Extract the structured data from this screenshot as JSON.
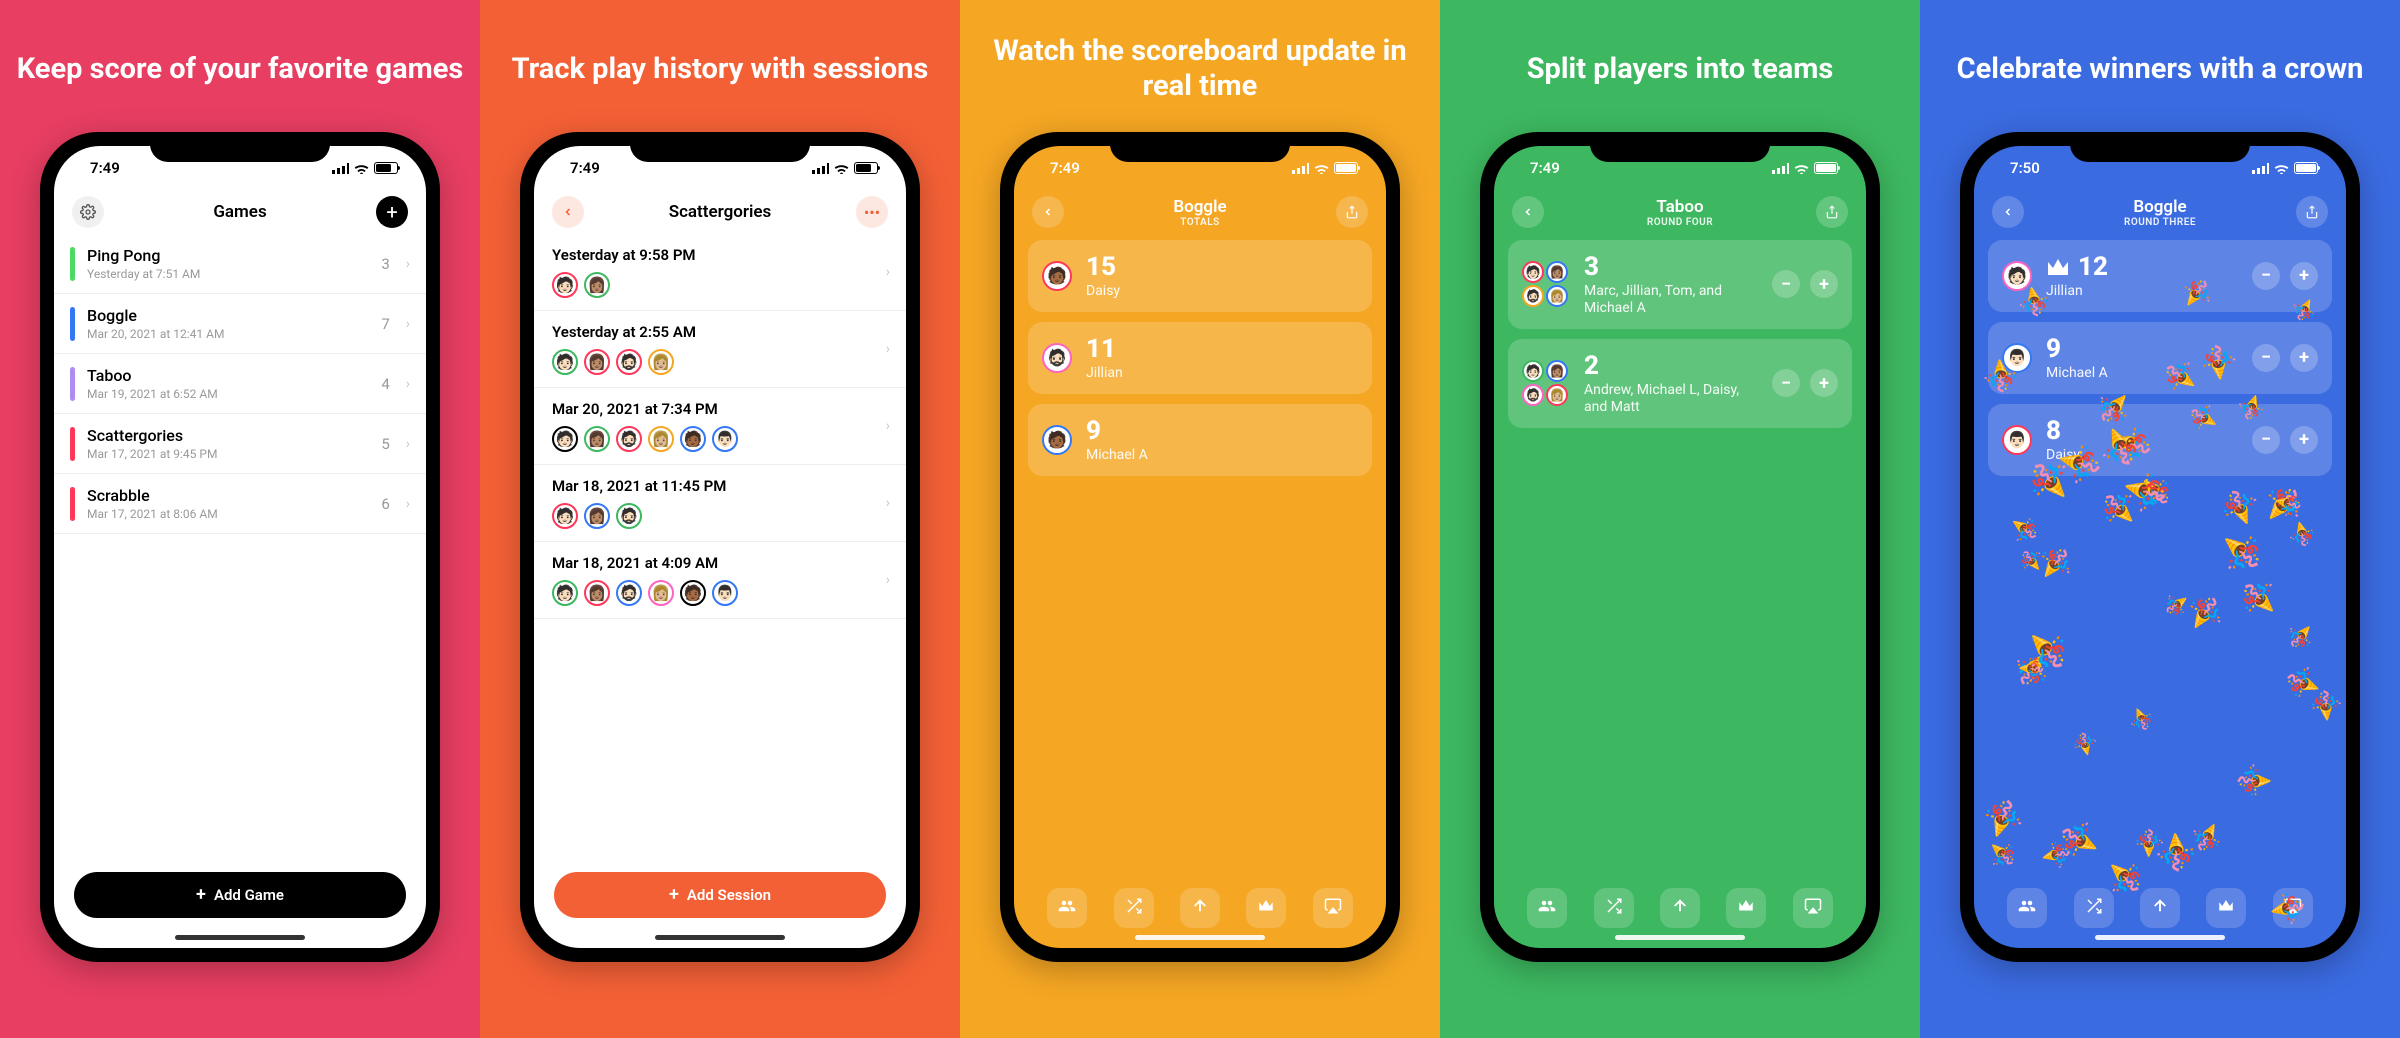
{
  "panels": [
    {
      "headline": "Keep score of your favorite games"
    },
    {
      "headline": "Track play history with sessions"
    },
    {
      "headline": "Watch the scoreboard update in real time"
    },
    {
      "headline": "Split players into teams"
    },
    {
      "headline": "Celebrate winners with a crown"
    }
  ],
  "status_time": {
    "a": "7:49",
    "b": "7:50"
  },
  "screen1": {
    "nav_title": "Games",
    "add_label": "Add Game",
    "games": [
      {
        "name": "Ping Pong",
        "sub": "Yesterday at 7:51 AM",
        "count": "3",
        "color": "#4cd964"
      },
      {
        "name": "Boggle",
        "sub": "Mar 20, 2021 at 12:41 AM",
        "count": "7",
        "color": "#3478f6"
      },
      {
        "name": "Taboo",
        "sub": "Mar 19, 2021 at 6:52 AM",
        "count": "4",
        "color": "#af8cf0"
      },
      {
        "name": "Scattergories",
        "sub": "Mar 17, 2021 at 9:45 PM",
        "count": "5",
        "color": "#ff3759"
      },
      {
        "name": "Scrabble",
        "sub": "Mar 17, 2021 at 8:06 AM",
        "count": "6",
        "color": "#ff3759"
      }
    ]
  },
  "screen2": {
    "nav_title": "Scattergories",
    "add_label": "Add Session",
    "sessions": [
      {
        "when": "Yesterday at 9:58 PM",
        "avatars": [
          "#ff3759",
          "#3db860"
        ]
      },
      {
        "when": "Yesterday at 2:55 AM",
        "avatars": [
          "#3db860",
          "#ff3759",
          "#ff3759",
          "#f5a623"
        ]
      },
      {
        "when": "Mar 20, 2021 at 7:34 PM",
        "avatars": [
          "#000",
          "#3db860",
          "#ff3759",
          "#f5a623",
          "#3478f6",
          "#3478f6"
        ]
      },
      {
        "when": "Mar 18, 2021 at 11:45 PM",
        "avatars": [
          "#ff3759",
          "#3478f6",
          "#3db860"
        ]
      },
      {
        "when": "Mar 18, 2021 at 4:09 AM",
        "avatars": [
          "#3db860",
          "#ff3759",
          "#3478f6",
          "#ff63c1",
          "#000",
          "#3478f6"
        ]
      }
    ]
  },
  "screen3": {
    "nav_title": "Boggle",
    "nav_subtitle": "TOTALS",
    "rows": [
      {
        "score": "15",
        "names": "Daisy",
        "ring": "#ff3759"
      },
      {
        "score": "11",
        "names": "Jillian",
        "ring": "#ff63c1"
      },
      {
        "score": "9",
        "names": "Michael A",
        "ring": "#3478f6"
      }
    ]
  },
  "screen4": {
    "nav_title": "Taboo",
    "nav_subtitle": "ROUND FOUR",
    "rows": [
      {
        "score": "3",
        "names": "Marc, Jillian, Tom, and Michael A",
        "rings": [
          "#ff3759",
          "#3478f6",
          "#f5a623",
          "#3478f6"
        ]
      },
      {
        "score": "2",
        "names": "Andrew, Michael L, Daisy, and Matt",
        "rings": [
          "#3db860",
          "#3478f6",
          "#ff63c1",
          "#ff3759"
        ]
      }
    ]
  },
  "screen5": {
    "nav_title": "Boggle",
    "nav_subtitle": "ROUND THREE",
    "rows": [
      {
        "score": "12",
        "names": "Jillian",
        "ring": "#ff63c1",
        "crown": true
      },
      {
        "score": "9",
        "names": "Michael A",
        "ring": "#3478f6"
      },
      {
        "score": "8",
        "names": "Daisy",
        "ring": "#ff3759"
      }
    ]
  },
  "toolbar_icons": [
    "people",
    "shuffle",
    "up-arrow",
    "crown",
    "airplay"
  ]
}
